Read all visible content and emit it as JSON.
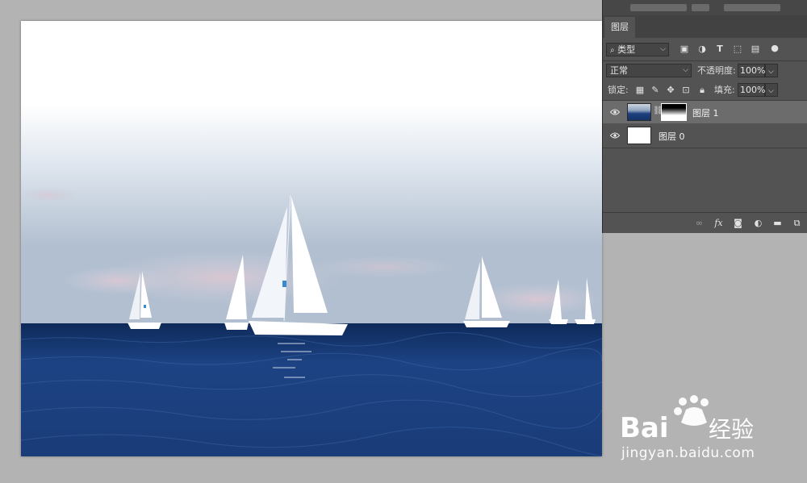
{
  "panel": {
    "tab_label": "图层",
    "filter_kind": "类型",
    "blend_mode": "正常",
    "opacity_label": "不透明度:",
    "opacity_value": "100%",
    "lock_label": "锁定:",
    "fill_label": "填充:",
    "fill_value": "100%"
  },
  "layers": [
    {
      "name": "图层",
      "index": "1",
      "visible": true,
      "has_mask": true,
      "active": true
    },
    {
      "name": "图层",
      "index": "0",
      "visible": true,
      "has_mask": false,
      "active": false
    }
  ],
  "colors": {
    "panel_bg": "#535353",
    "active_row": "#6c6c6c",
    "workspace_bg": "#b3b3b3",
    "sea_blue": "#1b3d78"
  },
  "icons": {
    "filter_icons": [
      "image-filter-icon",
      "adjustment-filter-icon",
      "type-filter-icon",
      "shape-filter-icon",
      "smart-object-filter-icon",
      "toggle-filter-icon"
    ],
    "lock_icons": [
      "lock-transparent-icon",
      "lock-paint-icon",
      "lock-move-icon",
      "lock-artboard-icon",
      "lock-all-icon"
    ],
    "bottom_icons": [
      "link-layers-icon",
      "fx-icon",
      "add-mask-icon",
      "new-adjustment-icon",
      "new-group-icon",
      "new-layer-icon"
    ]
  },
  "watermark": {
    "brand": "Bai du 经验",
    "url": "jingyan.baidu.com"
  }
}
